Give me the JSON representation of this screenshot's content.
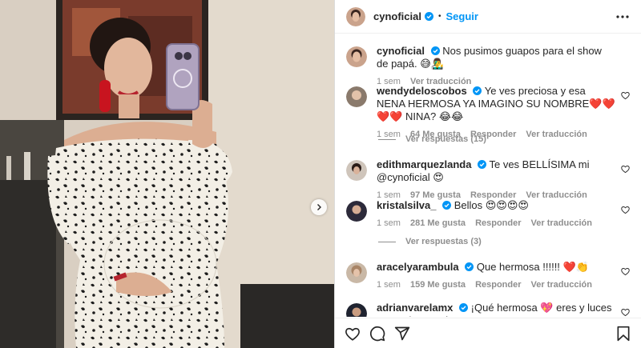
{
  "header": {
    "username": "cynoficial",
    "follow_label": "Seguir",
    "separator": "•"
  },
  "caption": {
    "username": "cynoficial",
    "text": "Nos pusimos guapos para el show de papá. 😅👨‍🎤",
    "time": "1 sem",
    "translate": "Ver traducción"
  },
  "comments": [
    {
      "username": "wendydeloscobos",
      "verified": true,
      "text": "Ye ves preciosa y esa NENA HERMOSA YA IMAGINO SU NOMBRE❤️❤️❤️❤️ NINA? 😂😂",
      "time": "1 sem",
      "likes": "64 Me gusta",
      "reply": "Responder",
      "translate": "Ver traducción",
      "replies_label": "Ver respuestas (15)"
    },
    {
      "username": "edithmarquezlanda",
      "verified": true,
      "text": "Te ves BELLÍSIMA mi @cynoficial 😍",
      "time": "1 sem",
      "likes": "97 Me gusta",
      "reply": "Responder",
      "translate": "Ver traducción"
    },
    {
      "username": "kristalsilva_",
      "verified": true,
      "text": "Bellos 😍😍😍😍",
      "time": "1 sem",
      "likes": "281 Me gusta",
      "reply": "Responder",
      "translate": "Ver traducción",
      "replies_label": "Ver respuestas (3)"
    },
    {
      "username": "aracelyarambula",
      "verified": true,
      "text": "Que hermosa !!!!!! ❤️👏",
      "time": "1 sem",
      "likes": "159 Me gusta",
      "reply": "Responder",
      "translate": "Ver traducción"
    },
    {
      "username": "adrianvarelamx",
      "verified": true,
      "text": "¡Qué hermosa 💖 eres y luces en modo Mamá!"
    }
  ],
  "colors": {
    "link": "#0095f6",
    "verified": "#0095f6",
    "meta": "#8e8e8e",
    "text": "#262626"
  },
  "icons": {
    "more": "more-options-icon",
    "like": "heart-icon",
    "comment": "comment-icon",
    "share": "send-icon",
    "save": "bookmark-icon",
    "next": "chevron-right-icon"
  }
}
